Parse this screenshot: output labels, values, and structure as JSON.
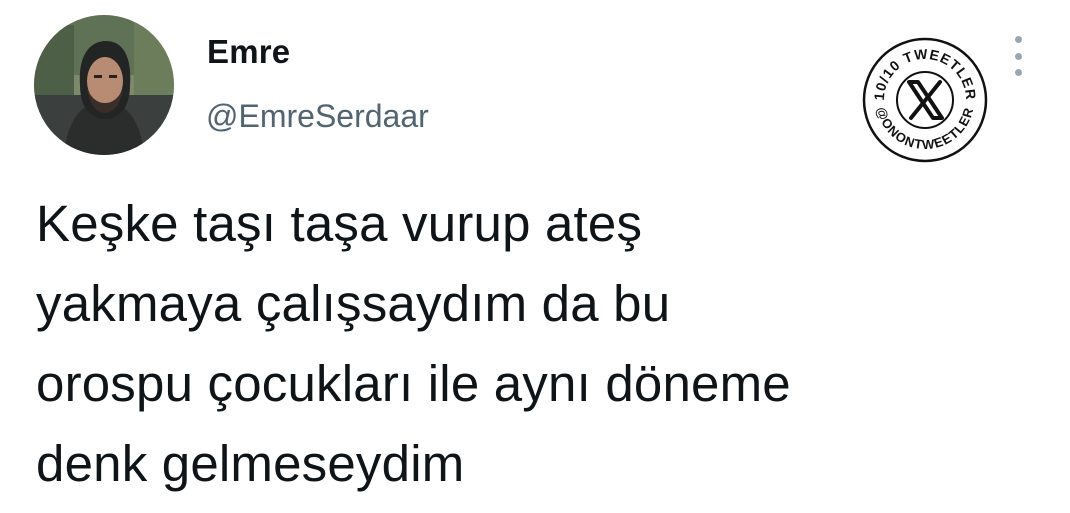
{
  "author": {
    "display_name": "Emre",
    "handle": "@EmreSerdaar"
  },
  "badge": {
    "top_text": "10/10 TWEETLER",
    "bottom_text": "@ONONTWEETLER",
    "icon": "x-logo-icon"
  },
  "menu_icon": "more-vertical-icon",
  "tweet": {
    "lines": [
      "Keşke taşı taşa vurup ateş",
      "yakmaya çalışsaydım da bu",
      "orospu çocukları ile aynı döneme",
      "denk gelmeseydim"
    ]
  }
}
